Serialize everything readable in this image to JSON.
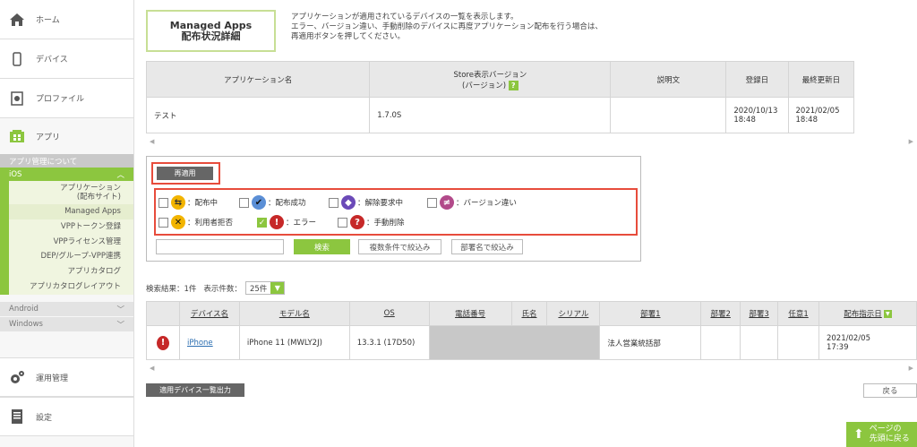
{
  "sidebar": {
    "home": "ホーム",
    "device": "デバイス",
    "profile": "プロファイル",
    "apps": "アプリ",
    "about_apps": "アプリ管理について",
    "ios": "iOS",
    "ios_items": [
      "アプリケーション",
      "(配布サイト)",
      "Managed Apps",
      "VPPトークン登録",
      "VPPライセンス管理",
      "DEP/グループ-VPP連携",
      "アプリカタログ",
      "アプリカタログレイアウト"
    ],
    "android": "Android",
    "windows": "Windows",
    "operations": "運用管理",
    "settings": "設定"
  },
  "header": {
    "title_line1": "Managed Apps",
    "title_line2": "配布状況詳細",
    "desc_line1": "アプリケーションが適用されているデバイスの一覧を表示します。",
    "desc_line2": "エラー、バージョン違い、手動削除のデバイスに再度アプリケーション配布を行う場合は、",
    "desc_line3": "再適用ボタンを押してください。"
  },
  "apps_table": {
    "headers": [
      "アプリケーション名",
      "Store表示バージョン",
      "(バージョン)",
      "説明文",
      "登録日",
      "最終更新日"
    ],
    "row": [
      "テスト",
      "1.7.0S",
      "",
      "2020/10/13",
      "18:48",
      "2021/02/05",
      "18:48"
    ]
  },
  "filter": {
    "reapply": "再適用",
    "legend": [
      "：配布中",
      "：配布成功",
      "：解除要求中",
      "：バージョン違い",
      "：利用者拒否",
      "：エラー",
      "：手動削除"
    ],
    "search": "検索",
    "multi_filter": "複数条件で絞込み",
    "dept_filter": "部署名で絞込み"
  },
  "results": {
    "summary": "検索結果：1件",
    "count_label": "表示件数：",
    "count_value": "25件"
  },
  "device_table": {
    "headers": [
      "デバイス名",
      "モデル名",
      "OS",
      "電話番号",
      "氏名",
      "シリアル",
      "部署1",
      "部署2",
      "部署3",
      "任意1",
      "配布指示日"
    ],
    "row": {
      "device": "iPhone",
      "model": "iPhone 11 (MWLY2J)",
      "os": "13.3.1 (17D50)",
      "dept1": "法人営業統括部",
      "date": "2021/02/05",
      "time": "17:39"
    }
  },
  "footer": {
    "export": "適用デバイス一覧出力",
    "back": "戻る",
    "top_line1": "ページの",
    "top_line2": "先頭に戻る"
  },
  "colors": {
    "accent": "#8cc63f",
    "highlight": "#e74c3c",
    "error": "#c62828"
  }
}
